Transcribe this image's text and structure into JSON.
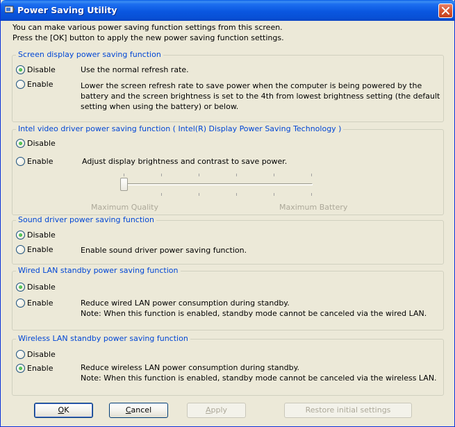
{
  "window": {
    "title": "Power Saving Utility"
  },
  "intro": {
    "line1": "You can make various power saving function settings from this screen.",
    "line2": "Press the [OK] button to apply the new power saving function settings."
  },
  "screen_display": {
    "title": "Screen display power saving function",
    "disable_label": "Disable",
    "enable_label": "Enable",
    "selected": "Disable",
    "disable_desc": "Use the normal refresh rate.",
    "enable_desc": [
      "Lower the screen refresh rate to save power when the computer is being powered by the",
      "battery and the screen brightness is set to the 4th from lowest brightness setting (the default",
      "setting when using the battery) or below."
    ]
  },
  "intel_video": {
    "title": "Intel video driver power saving function ( Intel(R) Display Power Saving Technology )",
    "disable_label": "Disable",
    "enable_label": "Enable",
    "selected": "Disable",
    "enable_desc": "Adjust display brightness and contrast to save power.",
    "slider": {
      "min_label": "Maximum Quality",
      "max_label": "Maximum Battery",
      "level": 0,
      "steps": 6
    }
  },
  "sound_driver": {
    "title": "Sound driver power saving function",
    "disable_label": "Disable",
    "enable_label": "Enable",
    "selected": "Disable",
    "enable_desc": "Enable sound driver power saving function."
  },
  "wired_lan": {
    "title": "Wired LAN standby power saving function",
    "disable_label": "Disable",
    "enable_label": "Enable",
    "selected": "Disable",
    "enable_desc": [
      "Reduce wired LAN power consumption during standby.",
      "Note: When this function is enabled, standby mode cannot be canceled via the wired LAN."
    ]
  },
  "wireless_lan": {
    "title": "Wireless LAN standby power saving function",
    "disable_label": "Disable",
    "enable_label": "Enable",
    "selected": "Enable",
    "enable_desc": [
      "Reduce wireless LAN power consumption during standby.",
      "Note: When this function is enabled, standby mode cannot be canceled via the wireless LAN."
    ]
  },
  "buttons": {
    "ok_hotkey": "O",
    "ok_rest": "K",
    "cancel_hotkey": "C",
    "cancel_rest": "ancel",
    "apply_hotkey": "A",
    "apply_rest": "pply",
    "restore": "Restore initial settings"
  },
  "colors": {
    "group_title": "#0046d5",
    "disabled_text": "#aca899",
    "window_bg": "#ece9d8"
  }
}
